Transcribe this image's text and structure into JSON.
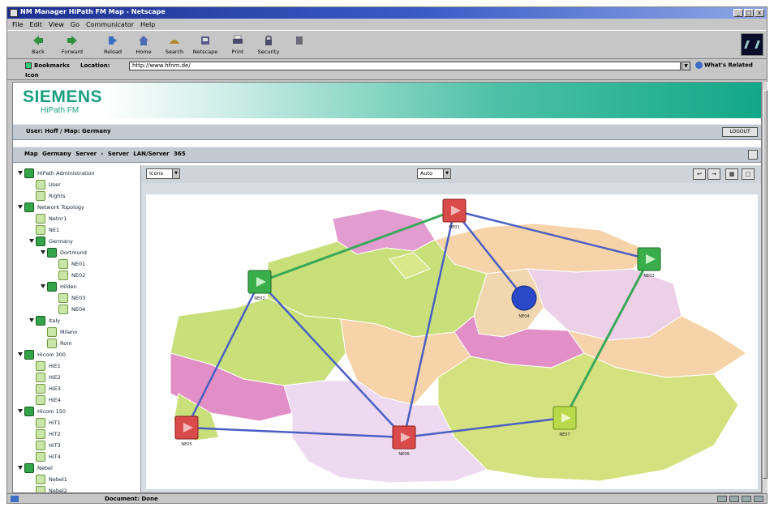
{
  "window": {
    "title": "NM Manager HiPath FM Map - Netscape",
    "controls": [
      "_",
      "□",
      "x"
    ]
  },
  "menubar": [
    "File",
    "Edit",
    "View",
    "Go",
    "Communicator",
    "Help"
  ],
  "toolbar": {
    "buttons": [
      {
        "label": "Back",
        "icon": "back-arrow-icon"
      },
      {
        "label": "Forward",
        "icon": "forward-arrow-icon"
      },
      {
        "label": "Reload",
        "icon": "reload-icon"
      },
      {
        "label": "Home",
        "icon": "home-icon"
      },
      {
        "label": "Search",
        "icon": "search-icon"
      },
      {
        "label": "Netscape",
        "icon": "netscape-icon"
      },
      {
        "label": "Print",
        "icon": "print-icon"
      },
      {
        "label": "Security",
        "icon": "security-icon"
      },
      {
        "label": "",
        "icon": "stop-icon"
      }
    ]
  },
  "location": {
    "bookmarks_label": "Bookmarks",
    "location_label": "Location:",
    "url": "http://www.hfnm.de/",
    "related_label": "What's Related",
    "sub_label": "Icon"
  },
  "banner": {
    "logo": "SIEMENS",
    "product": "HiPath FM"
  },
  "userbar": {
    "text": "User: Hoff / Map: Germany",
    "button": "LOGOUT"
  },
  "crumb": {
    "text": "Map  Germany  Server  ›  Server LAN/Server 365"
  },
  "tree": [
    {
      "label": "HiPath Administration",
      "level": 0,
      "leaf": false
    },
    {
      "label": "User",
      "level": 1,
      "leaf": true
    },
    {
      "label": "Rights",
      "level": 1,
      "leaf": true
    },
    {
      "label": "Network Topology",
      "level": 0,
      "leaf": false
    },
    {
      "label": "Netnr1",
      "level": 1,
      "leaf": true
    },
    {
      "label": "NE1",
      "level": 1,
      "leaf": true
    },
    {
      "label": "Germany",
      "level": 1,
      "leaf": false
    },
    {
      "label": "Dortmund",
      "level": 2,
      "leaf": false
    },
    {
      "label": "NE01",
      "level": 3,
      "leaf": true
    },
    {
      "label": "NE02",
      "level": 3,
      "leaf": true
    },
    {
      "label": "Hilden",
      "level": 2,
      "leaf": false
    },
    {
      "label": "NE03",
      "level": 3,
      "leaf": true
    },
    {
      "label": "NE04",
      "level": 3,
      "leaf": true
    },
    {
      "label": "Italy",
      "level": 1,
      "leaf": false
    },
    {
      "label": "Milano",
      "level": 2,
      "leaf": true
    },
    {
      "label": "Rom",
      "level": 2,
      "leaf": true
    },
    {
      "label": "Hicom 300",
      "level": 0,
      "leaf": false
    },
    {
      "label": "HiE1",
      "level": 1,
      "leaf": true
    },
    {
      "label": "HiE2",
      "level": 1,
      "leaf": true
    },
    {
      "label": "HiE3",
      "level": 1,
      "leaf": true
    },
    {
      "label": "HiE4",
      "level": 1,
      "leaf": true
    },
    {
      "label": "Hicom 150",
      "level": 0,
      "leaf": false
    },
    {
      "label": "HiT1",
      "level": 1,
      "leaf": true
    },
    {
      "label": "HiT2",
      "level": 1,
      "leaf": true
    },
    {
      "label": "HiT3",
      "level": 1,
      "leaf": true
    },
    {
      "label": "HiT4",
      "level": 1,
      "leaf": true
    },
    {
      "label": "Nebel",
      "level": 0,
      "leaf": false
    },
    {
      "label": "Nebel1",
      "level": 1,
      "leaf": true
    },
    {
      "label": "Nebel2",
      "level": 1,
      "leaf": true
    }
  ],
  "map": {
    "view_select": "Icons",
    "zoom_select": "Auto",
    "tools": [
      "↩",
      "→",
      "▦",
      "□"
    ],
    "colors": {
      "red": "#d94a4a",
      "green": "#3aae4a",
      "lightgreen": "#b8d94a",
      "blue": "#2a49c8",
      "link_blue": "#4a5fc4",
      "link_green": "#3aa85a"
    },
    "nodes": [
      {
        "id": "n1",
        "label": "NE01",
        "status": "critical",
        "color": "#d94a4a"
      },
      {
        "id": "n2",
        "label": "NE02",
        "status": "ok",
        "color": "#3aae4a"
      },
      {
        "id": "n3",
        "label": "NE03",
        "status": "ok",
        "color": "#3aae4a"
      },
      {
        "id": "n4",
        "label": "NE04",
        "status": "info",
        "color": "#2a49c8"
      },
      {
        "id": "n5",
        "label": "NE05",
        "status": "critical",
        "color": "#d94a4a"
      },
      {
        "id": "n6",
        "label": "NE06",
        "status": "critical",
        "color": "#d94a4a"
      },
      {
        "id": "n7",
        "label": "NE07",
        "status": "warning",
        "color": "#b8d94a"
      }
    ]
  },
  "status": {
    "text": "Document: Done"
  }
}
